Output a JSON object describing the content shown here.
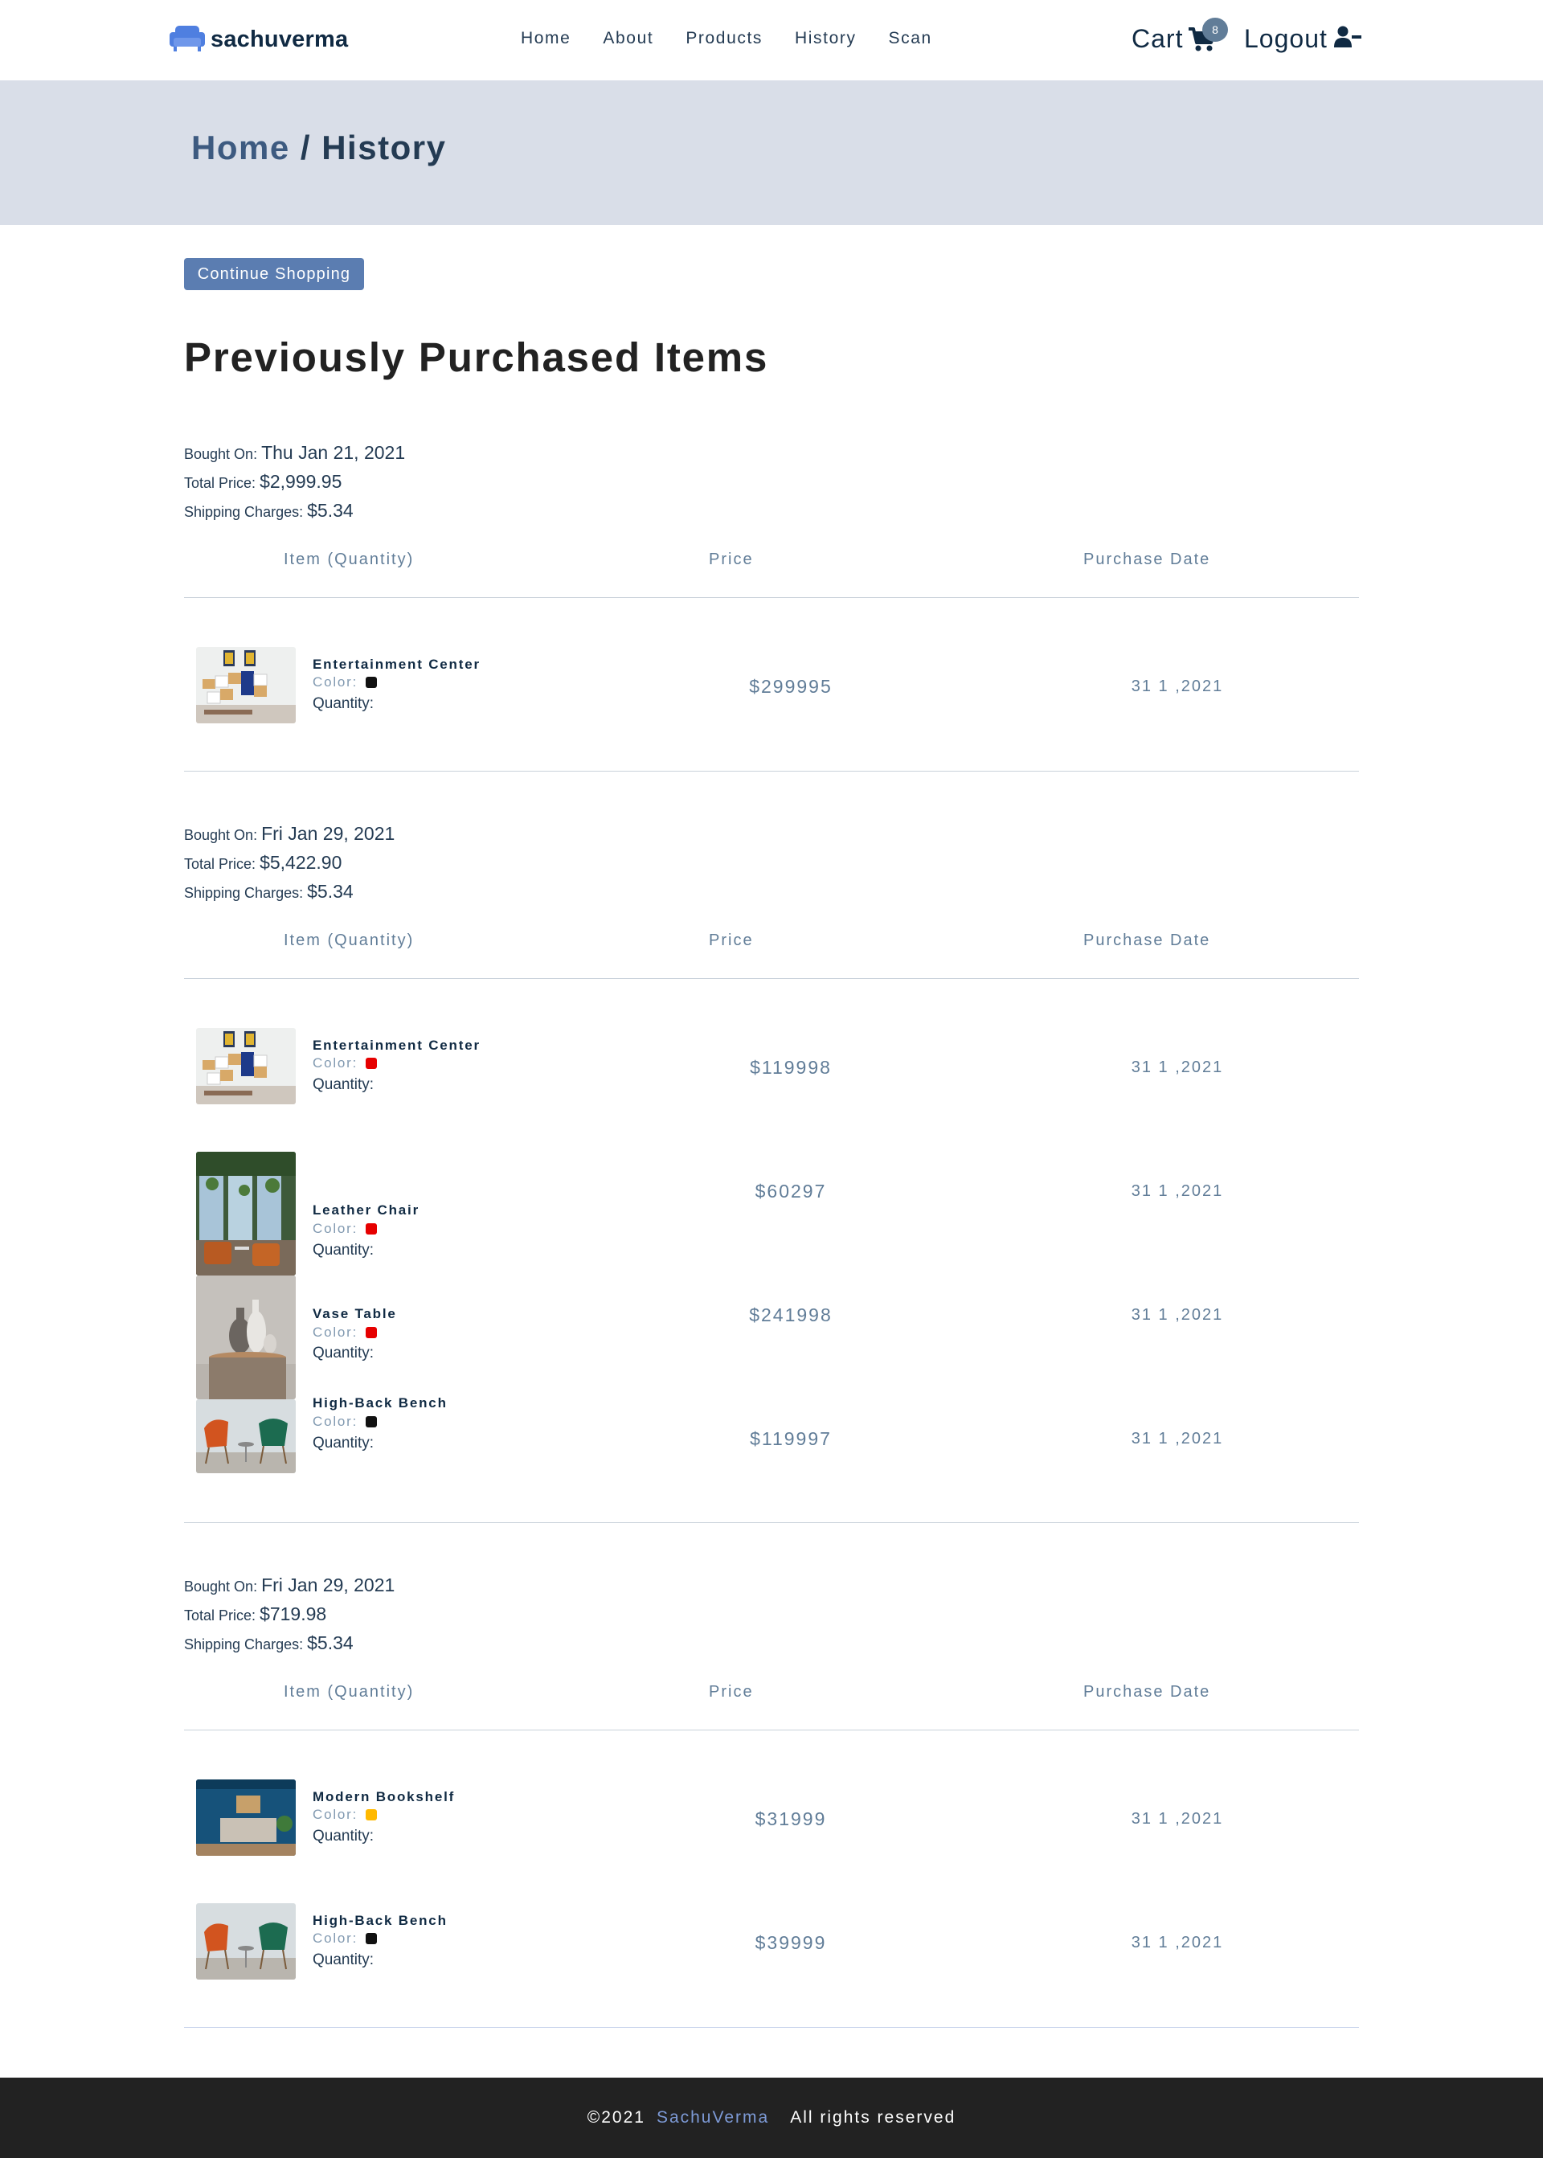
{
  "navbar": {
    "brand": "sachuverma",
    "links": [
      "Home",
      "About",
      "Products",
      "History",
      "Scan"
    ],
    "cart_label": "Cart",
    "cart_count": "8",
    "logout_label": "Logout",
    "brand_color": "#4f7fe0"
  },
  "hero": {
    "home": "Home",
    "separator": " / ",
    "current": "History"
  },
  "main": {
    "continue_label": "Continue Shopping",
    "title": "Previously Purchased Items",
    "labels": {
      "bought_on": "Bought On:",
      "total_price": "Total Price:",
      "shipping": "Shipping Charges:",
      "color": "Color:",
      "quantity": "Quantity:"
    },
    "columns": [
      "Item (Quantity)",
      "Price",
      "Purchase Date"
    ],
    "orders": [
      {
        "bought_on": "Thu Jan 21, 2021",
        "total_price": "$2,999.95",
        "shipping": "$5.34",
        "items": [
          {
            "name": "Entertainment Center",
            "color": "#111111",
            "price": "$299995",
            "date": "31 1 ,2021",
            "image": "entertainment-center"
          }
        ]
      },
      {
        "bought_on": "Fri Jan 29, 2021",
        "total_price": "$5,422.90",
        "shipping": "$5.34",
        "items": [
          {
            "name": "Entertainment Center",
            "color": "#e60000",
            "price": "$119998",
            "date": "31 1 ,2021",
            "image": "entertainment-center"
          },
          {
            "name": "Leather Chair",
            "color": "#e60000",
            "price": "$60297",
            "date": "31 1 ,2021",
            "image": "leather-chair"
          },
          {
            "name": "Vase Table",
            "color": "#e60000",
            "price": "$241998",
            "date": "31 1 ,2021",
            "image": "vase-table"
          },
          {
            "name": "High-Back Bench",
            "color": "#111111",
            "price": "$119997",
            "date": "31 1 ,2021",
            "image": "high-back-bench"
          }
        ]
      },
      {
        "bought_on": "Fri Jan 29, 2021",
        "total_price": "$719.98",
        "shipping": "$5.34",
        "items": [
          {
            "name": "Modern Bookshelf",
            "color": "#ffb900",
            "price": "$31999",
            "date": "31 1 ,2021",
            "image": "modern-bookshelf"
          },
          {
            "name": "High-Back Bench",
            "color": "#111111",
            "price": "$39999",
            "date": "31 1 ,2021",
            "image": "high-back-bench"
          }
        ]
      }
    ]
  },
  "footer": {
    "copyright": "©2021",
    "brand": "SachuVerma",
    "rights": "All rights reserved"
  }
}
